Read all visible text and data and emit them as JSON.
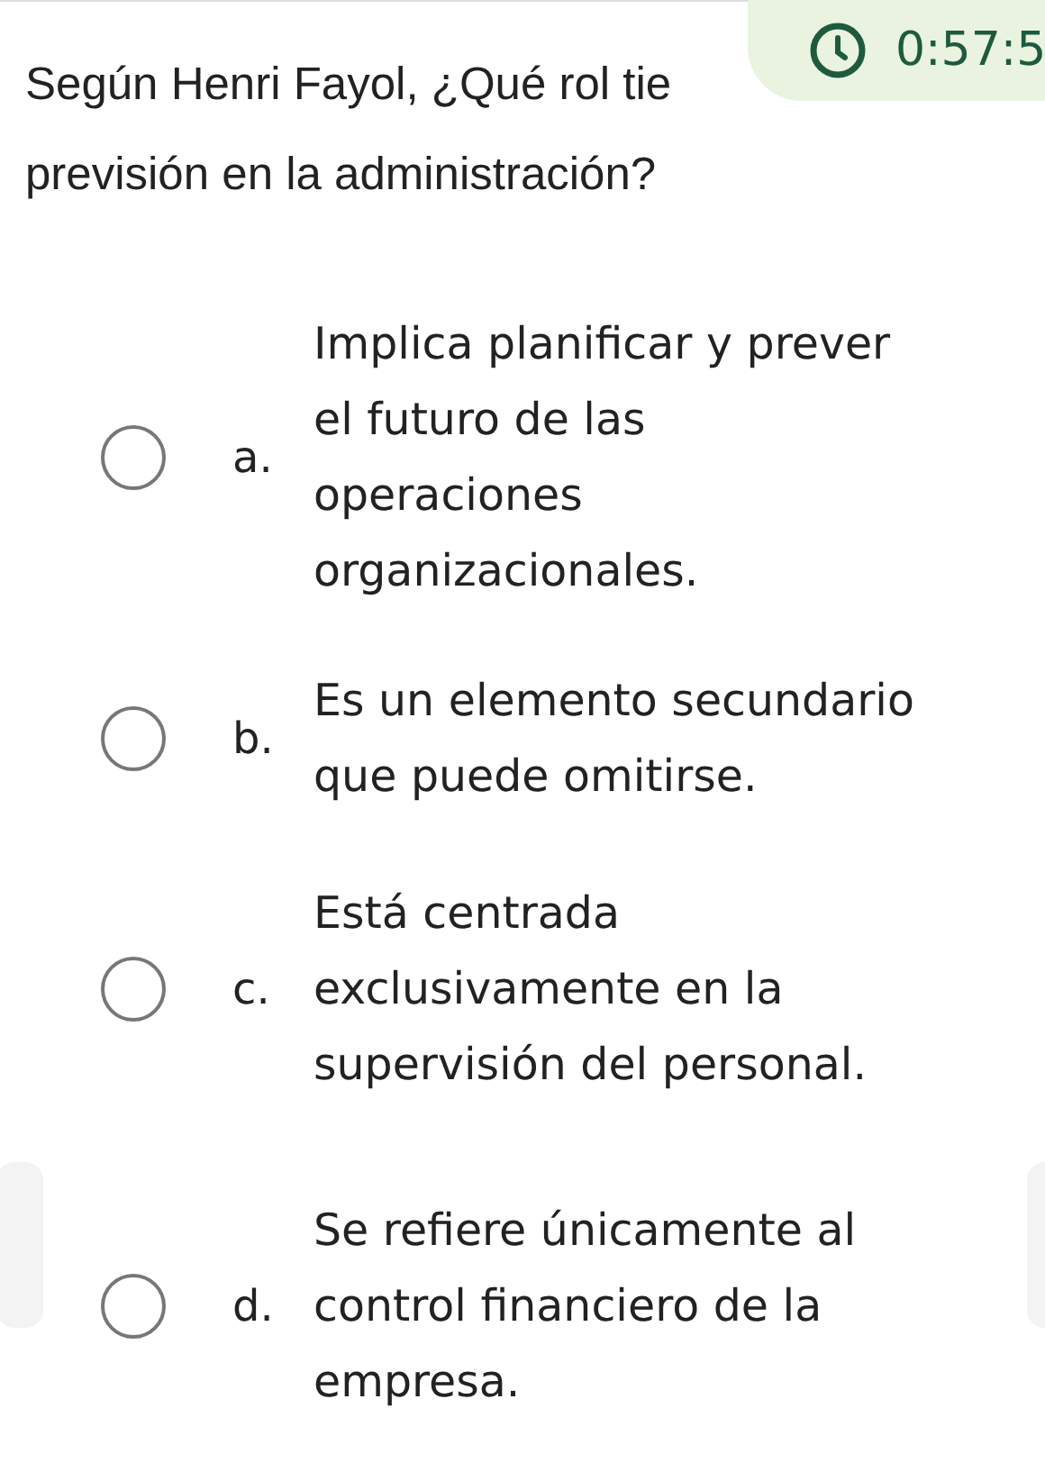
{
  "timer": {
    "time": "0:57:5"
  },
  "question": "Según Henri Fayol, ¿Qué rol tie\nprevisión en la administración?",
  "options": [
    {
      "letter": "a.",
      "text": "Implica planificar y prever\nel futuro de las\noperaciones\norganizacionales.",
      "selected": false
    },
    {
      "letter": "b.",
      "text": "Es un elemento secundario\nque puede omitirse.",
      "selected": false
    },
    {
      "letter": "c.",
      "text": "Está centrada\nexclusivamente en la\nsupervisión del personal.",
      "selected": false
    },
    {
      "letter": "d.",
      "text": "Se refiere únicamente al\ncontrol financiero de la\nempresa.",
      "selected": false
    }
  ]
}
